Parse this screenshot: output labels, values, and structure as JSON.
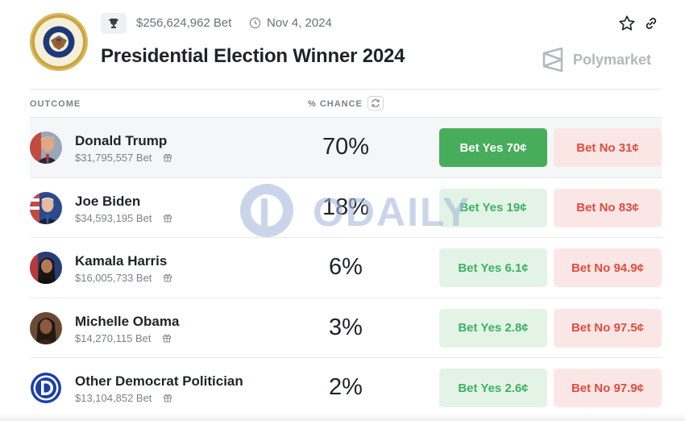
{
  "header": {
    "volume": "$256,624,962 Bet",
    "date": "Nov 4, 2024",
    "title": "Presidential Election Winner 2024",
    "brand": "Polymarket"
  },
  "table": {
    "col_outcome": "OUTCOME",
    "col_chance": "% CHANCE"
  },
  "outcomes": [
    {
      "name": "Donald Trump",
      "volume": "$31,795,557 Bet",
      "chance": "70%",
      "yes": "Bet Yes 70¢",
      "no": "Bet No 31¢"
    },
    {
      "name": "Joe Biden",
      "volume": "$34,593,195 Bet",
      "chance": "18%",
      "yes": "Bet Yes 19¢",
      "no": "Bet No 83¢"
    },
    {
      "name": "Kamala Harris",
      "volume": "$16,005,733 Bet",
      "chance": "6%",
      "yes": "Bet Yes 6.1¢",
      "no": "Bet No 94.9¢"
    },
    {
      "name": "Michelle Obama",
      "volume": "$14,270,115 Bet",
      "chance": "3%",
      "yes": "Bet Yes 2.8¢",
      "no": "Bet No 97.5¢"
    },
    {
      "name": "Other Democrat Politician",
      "volume": "$13,104,852 Bet",
      "chance": "2%",
      "yes": "Bet Yes 2.6¢",
      "no": "Bet No 97.9¢"
    }
  ],
  "watermark": "ODAILY",
  "colors": {
    "yes_active": "#47ad5b",
    "yes_text": "#3fb063",
    "no_text": "#e24c3c",
    "dem_blue": "#1b3fa8"
  },
  "icons": [
    "presidential-seal-icon",
    "trophy-icon",
    "clock-icon",
    "star-icon",
    "link-icon",
    "polymarket-logo-icon",
    "refresh-icon",
    "gift-icon"
  ]
}
